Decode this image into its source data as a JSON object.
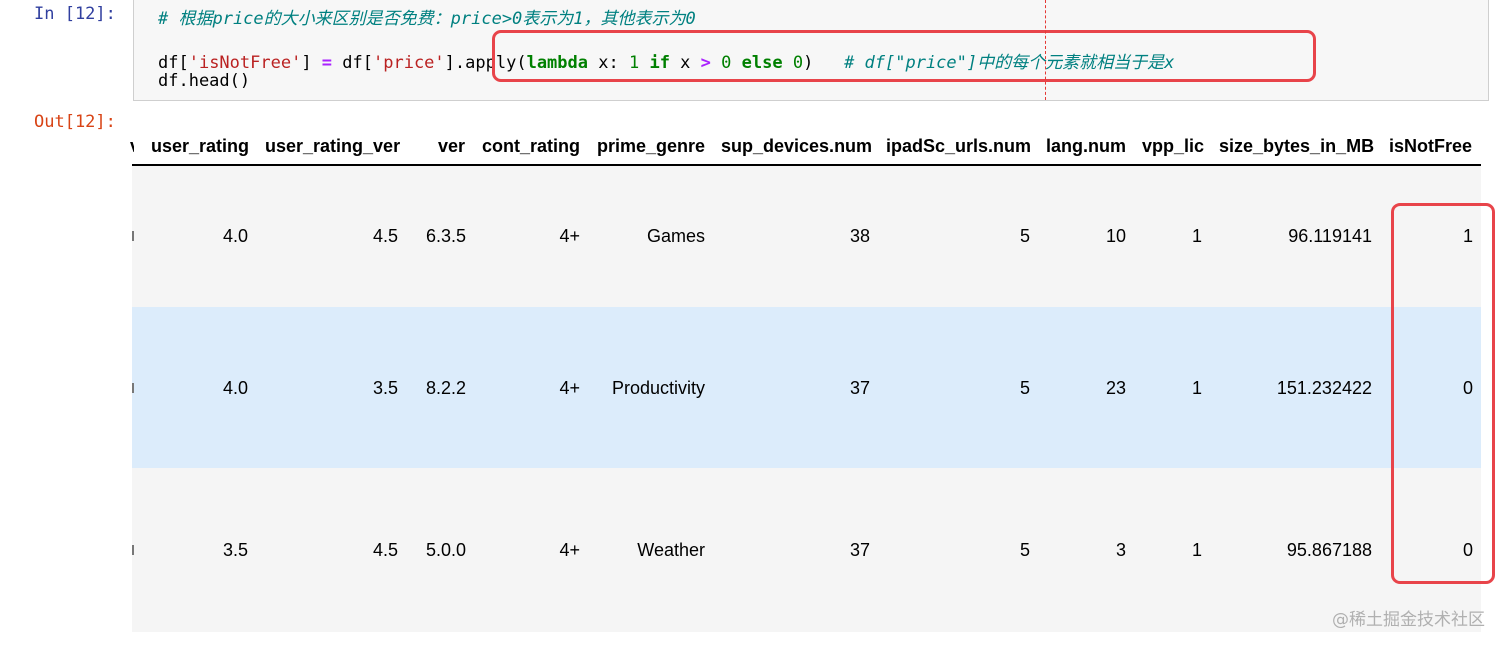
{
  "input_cell": {
    "prompt": "In [12]:",
    "comment_line": "# 根据price的大小来区别是否免费：price>0表示为1，其他表示为0",
    "code_line2": {
      "p1": "df[",
      "s1": "'isNotFree'",
      "p2": "] ",
      "eq": "=",
      "p3": " df[",
      "s2": "'price'",
      "p4": "]",
      "dot": ".",
      "apply": "apply(",
      "lambda": "lambda",
      "x_colon": " x: ",
      "one": "1",
      "sp1": " ",
      "kw_if": "if",
      "x2": " x ",
      "gt": ">",
      "sp2": " ",
      "zero": "0",
      "sp3": " ",
      "kw_else": "else",
      "sp4": " ",
      "zero2": "0",
      "close": ")",
      "comment": "   # df[\"price\"]中的每个元素就相当于是x"
    },
    "code_line3": "df.head()"
  },
  "output_cell": {
    "prompt": "Out[12]:",
    "columns": [
      "user_rating",
      "user_rating_ver",
      "ver",
      "cont_rating",
      "prime_genre",
      "sup_devices.num",
      "ipadSc_urls.num",
      "lang.num",
      "vpp_lic",
      "size_bytes_in_MB",
      "isNotFree"
    ],
    "rows": [
      [
        "4.0",
        "4.5",
        "6.3.5",
        "4+",
        "Games",
        "38",
        "5",
        "10",
        "1",
        "96.119141",
        "1"
      ],
      [
        "4.0",
        "3.5",
        "8.2.2",
        "4+",
        "Productivity",
        "37",
        "5",
        "23",
        "1",
        "151.232422",
        "0"
      ],
      [
        "3.5",
        "4.5",
        "5.0.0",
        "4+",
        "Weather",
        "37",
        "5",
        "3",
        "1",
        "95.867188",
        "0"
      ]
    ]
  },
  "watermark": "@稀土掘金技术社区",
  "colors": {
    "highlight_box": "#e8444a",
    "hover_row": "#dcecfb",
    "in_prompt": "#303f9f",
    "out_prompt": "#d84315"
  }
}
